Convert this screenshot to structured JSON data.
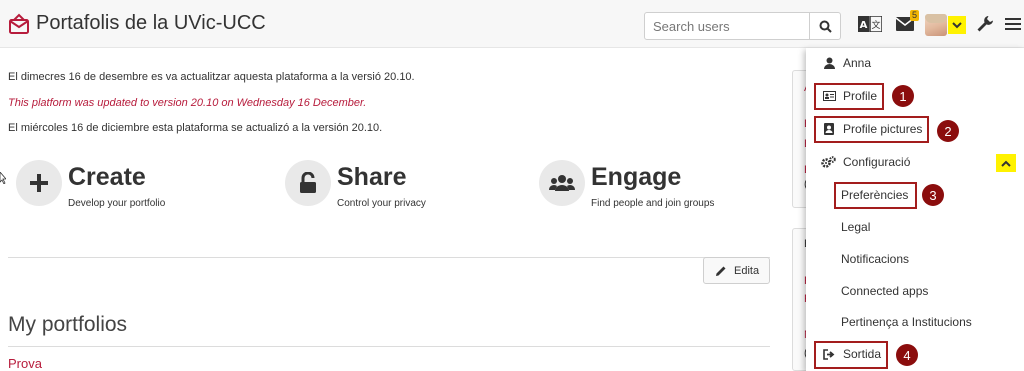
{
  "header": {
    "site_title": "Portafolis de la UVic-UCC",
    "search_placeholder": "Search users",
    "mail_count": "5",
    "icons": [
      "envelope-logo-icon",
      "search-icon",
      "language-icon",
      "mail-icon",
      "avatar",
      "chevron-down-icon",
      "wrench-icon",
      "menu-icon"
    ]
  },
  "notices": [
    "El dimecres 16 de desembre es va actualitzar aquesta plataforma a la versió 20.10.",
    "This platform was updated to version 20.10 on Wednesday 16 December.",
    "El miércoles 16 de diciembre esta plataforma se actualizó a la versión 20.10."
  ],
  "features": [
    {
      "title": "Create",
      "subtitle": "Develop your portfolio",
      "icon": "plus-icon"
    },
    {
      "title": "Share",
      "subtitle": "Control your privacy",
      "icon": "unlock-icon"
    },
    {
      "title": "Engage",
      "subtitle": "Find people and join groups",
      "icon": "users-icon"
    }
  ],
  "edit_label": "Edita",
  "my_portfolios": {
    "title": "My portfolios",
    "items": [
      "Prova"
    ]
  },
  "side_fragments": [
    "A",
    "E",
    "E",
    "E",
    "(",
    "E",
    "F",
    "F",
    "N",
    "("
  ],
  "user_menu": {
    "username": "Anna",
    "profile": "Profile",
    "profile_pictures": "Profile pictures",
    "settings": "Configuració",
    "sub_items": [
      "Preferències",
      "Legal",
      "Notificacions",
      "Connected apps",
      "Pertinença a Institucions"
    ],
    "logout": "Sortida"
  },
  "annotations": [
    "1",
    "2",
    "3",
    "4"
  ],
  "colors": {
    "accent": "#b71c3c",
    "highlight_box": "#a31d1d",
    "badge": "#8b0d0d",
    "marker": "#fff200",
    "header_bg": "#f7f7f7"
  }
}
